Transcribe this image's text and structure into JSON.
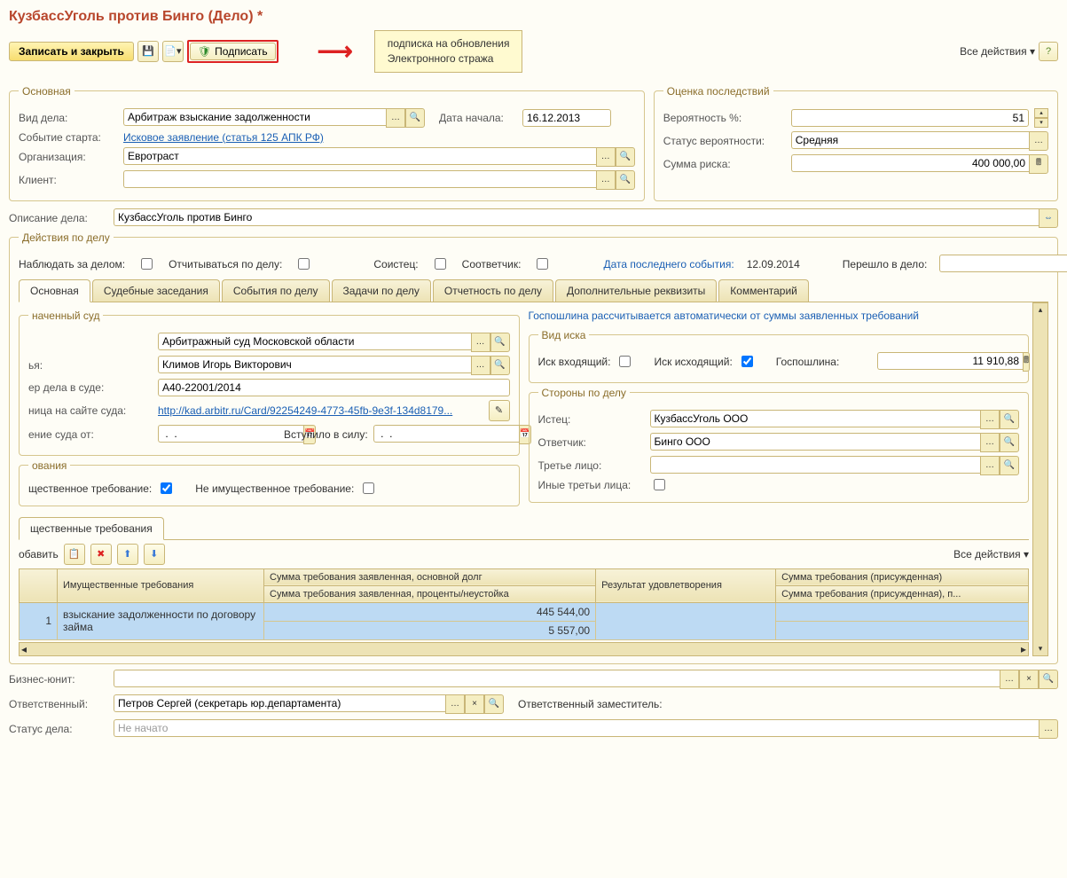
{
  "title": "КузбассУголь против Бинго (Дело) *",
  "toolbar": {
    "save_close": "Записать и закрыть",
    "sign": "Подписать",
    "all_actions": "Все действия"
  },
  "tooltip": {
    "line1": "подписка на обновления",
    "line2": "Электронного стража"
  },
  "main": {
    "legend": "Основная",
    "case_type_lbl": "Вид дела:",
    "case_type": "Арбитраж взыскание задолженности",
    "start_date_lbl": "Дата начала:",
    "start_date": "16.12.2013",
    "start_event_lbl": "Событие старта:",
    "start_event": "Исковое заявление (статья 125 АПК РФ)",
    "org_lbl": "Организация:",
    "org": "Евротраст",
    "client_lbl": "Клиент:",
    "client": ""
  },
  "risk": {
    "legend": "Оценка последствий",
    "prob_lbl": "Вероятность %:",
    "prob": "51",
    "status_lbl": "Статус вероятности:",
    "status": "Средняя",
    "sum_lbl": "Сумма риска:",
    "sum": "400 000,00"
  },
  "desc_lbl": "Описание дела:",
  "desc": "КузбассУголь против Бинго",
  "actions": {
    "legend": "Действия по делу",
    "watch": "Наблюдать за делом:",
    "report": "Отчитываться по делу:",
    "coplaintiff": "Соистец:",
    "codefendant": "Соответчик:",
    "last_event_lbl": "Дата последнего события:",
    "last_event": "12.09.2014",
    "moved_lbl": "Перешло в дело:"
  },
  "tabs": [
    "Основная",
    "Судебные заседания",
    "События по делу",
    "Задачи по делу",
    "Отчетность по делу",
    "Дополнительные реквизиты",
    "Комментарий"
  ],
  "court": {
    "legend": "наченный суд",
    "name": "Арбитражный суд Московской области",
    "judge_lbl": "ья:",
    "judge": "Климов Игорь Викторович",
    "num_lbl": "ер дела в суде:",
    "num": "A40-22001/2014",
    "page_lbl": "ница на сайте суда:",
    "page": "http://kad.arbitr.ru/Card/92254249-4773-45fb-9e3f-134d8179...",
    "decision_lbl": "ение суда от:",
    "decision": " .  .    ",
    "inforce_lbl": "Вступило в силу:",
    "inforce": " .  .    "
  },
  "notice": "Госпошлина рассчитывается автоматически от суммы заявленных требований",
  "claim_type": {
    "legend": "Вид иска",
    "incoming": "Иск входящий:",
    "outgoing": "Иск исходящий:",
    "fee_lbl": "Госпошлина:",
    "fee": "11 910,88"
  },
  "parties": {
    "legend": "Стороны по делу",
    "plaintiff_lbl": "Истец:",
    "plaintiff": "КузбассУголь ООО",
    "defendant_lbl": "Ответчик:",
    "defendant": "Бинго ООО",
    "third_lbl": "Третье лицо:",
    "third": "",
    "other_lbl": "Иные третьи лица:"
  },
  "demands": {
    "legend": "ования",
    "property": "щественное требование:",
    "nonproperty": "Не имущественное требование:",
    "subtab": "щественные требования",
    "add": "обавить",
    "all_actions": "Все действия",
    "cols": {
      "c1": "Имущественные требования",
      "c2a": "Сумма требования заявленная, основной долг",
      "c2b": "Сумма требования заявленная, проценты/неустойка",
      "c3": "Результат удовлетворения",
      "c4a": "Сумма требования (присужденная)",
      "c4b": "Сумма требования (присужденная), п..."
    },
    "rows": [
      {
        "n": "1",
        "name": "взыскание задолженности по договору займа",
        "v1": "445 544,00",
        "v2": "5 557,00"
      }
    ]
  },
  "footer": {
    "unit_lbl": "Бизнес-юнит:",
    "resp_lbl": "Ответственный:",
    "resp": "Петров Сергей (секретарь юр.департамента)",
    "deputy_lbl": "Ответственный заместитель:",
    "status_lbl": "Статус дела:",
    "status": "Не начато"
  }
}
